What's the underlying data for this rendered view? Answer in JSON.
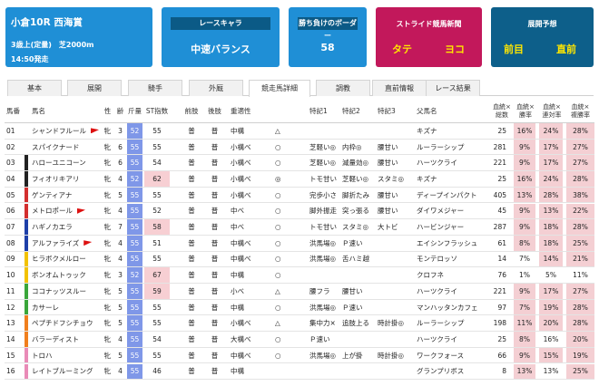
{
  "race": {
    "title": "小倉10R 西海賞",
    "conditions": "3歳上(定量)　芝2000m",
    "start_time": "14:50発走"
  },
  "chara": {
    "label": "レースキャラ",
    "value": "中速バランス"
  },
  "border": {
    "label": "勝ち負けのボーダー",
    "value": "58"
  },
  "stride": {
    "label": "ストライド競馬新聞",
    "left": "タテ",
    "right": "ヨコ"
  },
  "tenkai": {
    "label": "展開予想",
    "left": "前目",
    "right": "直前"
  },
  "tabs": [
    "基本",
    "展開",
    "騎手",
    "外厩",
    "競走馬詳細",
    "調教",
    "直前情報",
    "レース結果"
  ],
  "active_tab": "競走馬詳細",
  "columns": [
    "馬番",
    "馬名",
    "性",
    "齢",
    "斤量",
    "ST指数",
    "前肢",
    "後肢",
    "重適性",
    "特記1",
    "特記2",
    "特記3",
    "父馬名",
    "血統×総数",
    "血統×勝率",
    "血統×連対率",
    "血統×複勝率"
  ],
  "rows": [
    {
      "no": "01",
      "band": "#ffffff",
      "name": "シャンドフルール",
      "flag": true,
      "sex": "牝",
      "age": "3",
      "kin": "52",
      "kin_hi": true,
      "st": "55",
      "st_hi": false,
      "fore": "普",
      "hind": "普",
      "track": "中構",
      "heavy": "△",
      "t1": "",
      "t2": "",
      "t3": "",
      "sire": "キズナ",
      "total": "25",
      "win": "16%",
      "win_hi": true,
      "place2": "24%",
      "place2_hi": true,
      "place3": "28%",
      "place3_hi": true
    },
    {
      "no": "02",
      "band": "#ffffff",
      "name": "スパイクナード",
      "flag": false,
      "sex": "牝",
      "age": "6",
      "kin": "55",
      "kin_hi": true,
      "st": "55",
      "st_hi": false,
      "fore": "普",
      "hind": "普",
      "track": "小構ベ",
      "heavy": "○",
      "t1": "芝軽い◎",
      "t2": "内枠◎",
      "t3": "腰甘い",
      "sire": "ルーラーシップ",
      "total": "281",
      "win": "9%",
      "win_hi": true,
      "place2": "17%",
      "place2_hi": true,
      "place3": "27%",
      "place3_hi": true
    },
    {
      "no": "03",
      "band": "#222222",
      "name": "ハローユニコーン",
      "flag": false,
      "sex": "牝",
      "age": "6",
      "kin": "55",
      "kin_hi": true,
      "st": "54",
      "st_hi": false,
      "fore": "普",
      "hind": "普",
      "track": "小構ベ",
      "heavy": "○",
      "t1": "芝軽い◎",
      "t2": "減量効◎",
      "t3": "腰甘い",
      "sire": "ハーツクライ",
      "total": "221",
      "win": "9%",
      "win_hi": true,
      "place2": "17%",
      "place2_hi": true,
      "place3": "27%",
      "place3_hi": true
    },
    {
      "no": "04",
      "band": "#222222",
      "name": "フィオリキアリ",
      "flag": false,
      "sex": "牝",
      "age": "4",
      "kin": "52",
      "kin_hi": true,
      "st": "62",
      "st_hi": true,
      "fore": "普",
      "hind": "普",
      "track": "小構ベ",
      "heavy": "◎",
      "t1": "トモ甘い",
      "t2": "芝軽い◎",
      "t3": "スタミ◎",
      "sire": "キズナ",
      "total": "25",
      "win": "16%",
      "win_hi": true,
      "place2": "24%",
      "place2_hi": true,
      "place3": "28%",
      "place3_hi": true
    },
    {
      "no": "05",
      "band": "#d32f2f",
      "name": "ゲンティアナ",
      "flag": false,
      "sex": "牝",
      "age": "5",
      "kin": "55",
      "kin_hi": true,
      "st": "55",
      "st_hi": false,
      "fore": "普",
      "hind": "普",
      "track": "小構ベ",
      "heavy": "○",
      "t1": "完歩小さ",
      "t2": "脚折たみ",
      "t3": "腰甘い",
      "sire": "ディープインパクト",
      "total": "405",
      "win": "13%",
      "win_hi": true,
      "place2": "28%",
      "place2_hi": true,
      "place3": "38%",
      "place3_hi": true
    },
    {
      "no": "06",
      "band": "#d32f2f",
      "name": "メトロポール",
      "flag": true,
      "sex": "牝",
      "age": "4",
      "kin": "55",
      "kin_hi": true,
      "st": "52",
      "st_hi": false,
      "fore": "普",
      "hind": "普",
      "track": "中ベ",
      "heavy": "○",
      "t1": "脚外振走",
      "t2": "突っ張る",
      "t3": "腰甘い",
      "sire": "ダイワメジャー",
      "total": "45",
      "win": "9%",
      "win_hi": true,
      "place2": "13%",
      "place2_hi": true,
      "place3": "22%",
      "place3_hi": true
    },
    {
      "no": "07",
      "band": "#1e3fa8",
      "name": "ハギノカエラ",
      "flag": false,
      "sex": "牝",
      "age": "7",
      "kin": "55",
      "kin_hi": true,
      "st": "58",
      "st_hi": true,
      "fore": "普",
      "hind": "普",
      "track": "中ベ",
      "heavy": "○",
      "t1": "トモ甘い",
      "t2": "スタミ◎",
      "t3": "大トビ",
      "sire": "ハービンジャー",
      "total": "287",
      "win": "9%",
      "win_hi": true,
      "place2": "18%",
      "place2_hi": true,
      "place3": "28%",
      "place3_hi": true
    },
    {
      "no": "08",
      "band": "#1e3fa8",
      "name": "アルファライズ",
      "flag": true,
      "sex": "牝",
      "age": "4",
      "kin": "55",
      "kin_hi": true,
      "st": "51",
      "st_hi": false,
      "fore": "普",
      "hind": "普",
      "track": "中構ベ",
      "heavy": "○",
      "t1": "洪馬場◎",
      "t2": "Ｐ速い",
      "t3": "",
      "sire": "エイシンフラッシュ",
      "total": "61",
      "win": "8%",
      "win_hi": true,
      "place2": "18%",
      "place2_hi": true,
      "place3": "25%",
      "place3_hi": true
    },
    {
      "no": "09",
      "band": "#f2c200",
      "name": "ヒラボクメルロー",
      "flag": false,
      "sex": "牝",
      "age": "4",
      "kin": "55",
      "kin_hi": true,
      "st": "55",
      "st_hi": false,
      "fore": "普",
      "hind": "普",
      "track": "中構ベ",
      "heavy": "○",
      "t1": "洪馬場◎",
      "t2": "舌ハミ越",
      "t3": "",
      "sire": "モンテロッソ",
      "total": "14",
      "win": "7%",
      "win_hi": false,
      "place2": "14%",
      "place2_hi": true,
      "place3": "21%",
      "place3_hi": true
    },
    {
      "no": "10",
      "band": "#f2c200",
      "name": "ボンオムトゥック",
      "flag": false,
      "sex": "牝",
      "age": "3",
      "kin": "52",
      "kin_hi": true,
      "st": "67",
      "st_hi": true,
      "fore": "普",
      "hind": "普",
      "track": "中構",
      "heavy": "○",
      "t1": "",
      "t2": "",
      "t3": "",
      "sire": "クロフネ",
      "total": "76",
      "win": "1%",
      "win_hi": false,
      "place2": "5%",
      "place2_hi": false,
      "place3": "11%",
      "place3_hi": false
    },
    {
      "no": "11",
      "band": "#3aa63a",
      "name": "ココナッツスルー",
      "flag": false,
      "sex": "牝",
      "age": "5",
      "kin": "55",
      "kin_hi": true,
      "st": "59",
      "st_hi": true,
      "fore": "普",
      "hind": "普",
      "track": "小ベ",
      "heavy": "△",
      "t1": "腰フラ",
      "t2": "腰甘い",
      "t3": "",
      "sire": "ハーツクライ",
      "total": "221",
      "win": "9%",
      "win_hi": true,
      "place2": "17%",
      "place2_hi": true,
      "place3": "27%",
      "place3_hi": true
    },
    {
      "no": "12",
      "band": "#3aa63a",
      "name": "カサーレ",
      "flag": false,
      "sex": "牝",
      "age": "5",
      "kin": "55",
      "kin_hi": true,
      "st": "55",
      "st_hi": false,
      "fore": "普",
      "hind": "普",
      "track": "中構",
      "heavy": "○",
      "t1": "洪馬場◎",
      "t2": "Ｐ速い",
      "t3": "",
      "sire": "マンハッタンカフェ",
      "total": "97",
      "win": "7%",
      "win_hi": true,
      "place2": "19%",
      "place2_hi": true,
      "place3": "28%",
      "place3_hi": true
    },
    {
      "no": "13",
      "band": "#f07f1e",
      "name": "ペプチドフシチョウ",
      "flag": false,
      "sex": "牝",
      "age": "5",
      "kin": "55",
      "kin_hi": true,
      "st": "55",
      "st_hi": false,
      "fore": "普",
      "hind": "普",
      "track": "小構ベ",
      "heavy": "△",
      "t1": "集中力×",
      "t2": "追肢上る",
      "t3": "時計掛◎",
      "sire": "ルーラーシップ",
      "total": "198",
      "win": "11%",
      "win_hi": true,
      "place2": "20%",
      "place2_hi": true,
      "place3": "28%",
      "place3_hi": true
    },
    {
      "no": "14",
      "band": "#f07f1e",
      "name": "バラーディスト",
      "flag": false,
      "sex": "牝",
      "age": "4",
      "kin": "55",
      "kin_hi": true,
      "st": "54",
      "st_hi": false,
      "fore": "普",
      "hind": "普",
      "track": "大構ベ",
      "heavy": "○",
      "t1": "Ｐ速い",
      "t2": "",
      "t3": "",
      "sire": "ハーツクライ",
      "total": "25",
      "win": "8%",
      "win_hi": true,
      "place2": "16%",
      "place2_hi": false,
      "place3": "20%",
      "place3_hi": true
    },
    {
      "no": "15",
      "band": "#e98bb7",
      "name": "トロハ",
      "flag": false,
      "sex": "牝",
      "age": "5",
      "kin": "55",
      "kin_hi": true,
      "st": "55",
      "st_hi": false,
      "fore": "普",
      "hind": "普",
      "track": "中構ベ",
      "heavy": "○",
      "t1": "洪馬場◎",
      "t2": "上が掛",
      "t3": "時計掛◎",
      "sire": "ワークフォース",
      "total": "66",
      "win": "9%",
      "win_hi": true,
      "place2": "15%",
      "place2_hi": true,
      "place3": "19%",
      "place3_hi": true
    },
    {
      "no": "16",
      "band": "#e98bb7",
      "name": "レイトブルーミング",
      "flag": false,
      "sex": "牝",
      "age": "4",
      "kin": "55",
      "kin_hi": true,
      "st": "46",
      "st_hi": false,
      "fore": "普",
      "hind": "普",
      "track": "中構",
      "heavy": "",
      "t1": "",
      "t2": "",
      "t3": "",
      "sire": "グランプリボス",
      "total": "8",
      "win": "13%",
      "win_hi": true,
      "place2": "13%",
      "place2_hi": false,
      "place3": "25%",
      "place3_hi": true
    }
  ]
}
